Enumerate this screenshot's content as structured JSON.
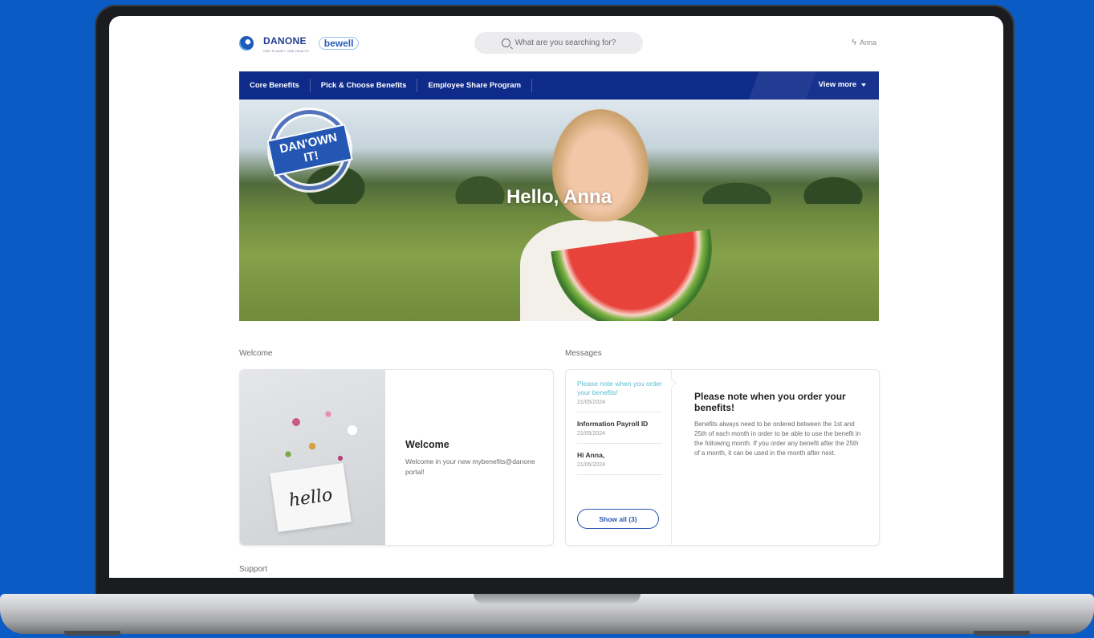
{
  "header": {
    "logo_text": "DANONE",
    "logo_sub": "ONE PLANET. ONE HEALTH",
    "bewell_text": "bewell",
    "search_placeholder": "What are you searching for?",
    "user_name": "Anna"
  },
  "nav": {
    "items": [
      {
        "label": "Core Benefits"
      },
      {
        "label": "Pick & Choose Benefits"
      },
      {
        "label": "Employee Share Program"
      }
    ],
    "view_more": "View more"
  },
  "hero": {
    "title": "Hello, Anna",
    "stamp_text": "DAN'OWN IT!"
  },
  "welcome": {
    "section_label": "Welcome",
    "card_image_text": "hello",
    "title": "Welcome",
    "body": "Welcome in your new mybenefits@danone portal!"
  },
  "messages": {
    "section_label": "Messages",
    "items": [
      {
        "title": "Please note when you order your benefits!",
        "date": "21/05/2024"
      },
      {
        "title": "Information Payroll ID",
        "date": "21/05/2024"
      },
      {
        "title": "Hi Anna,",
        "date": "21/05/2024"
      }
    ],
    "show_all": "Show all (3)",
    "detail_title": "Please note when you order your benefits!",
    "detail_body": "Benefits always need to be ordered between the 1st and 25th of each month in order to be able to use the benefit in the following month. If you order any benefit after the 25th of a month, it can be used in the month after next."
  },
  "support": {
    "section_label": "Support"
  },
  "colors": {
    "background": "#0a5bc4",
    "nav": "#0f2b8a",
    "accent": "#2a55b0",
    "active_message": "#5bbfd1"
  }
}
